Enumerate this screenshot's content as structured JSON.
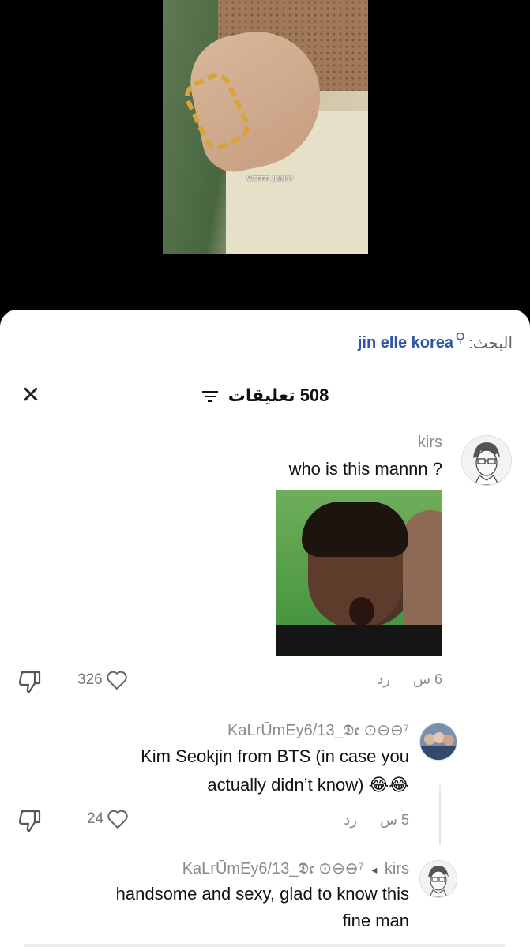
{
  "video": {
    "caption": "WTFFF JINN??"
  },
  "search": {
    "prefix": "البحث:",
    "query": "jin elle korea"
  },
  "header": {
    "title": "508 تعليقات"
  },
  "comments": [
    {
      "user": "kirs",
      "text": "who is this mannn ?",
      "time": "6 س",
      "reply": "رد",
      "likes": "326"
    },
    {
      "user": "KaLrŪmEy6/13_𝕯𝖈 ⊙⊖⊖⁷",
      "text_line1": "Kim Seokjin from BTS (in case you",
      "text_line2": "actually didn’t know) 😂😂",
      "time": "5 س",
      "reply": "رد",
      "likes": "24"
    },
    {
      "user": "KaLrŪmEy6/13_𝕯𝖈 ⊙⊖⊖⁷",
      "reply_arrow": "◂",
      "reply_to": "kirs",
      "text_line1": "handsome and sexy, glad to know this",
      "text_line2": "fine man"
    }
  ]
}
